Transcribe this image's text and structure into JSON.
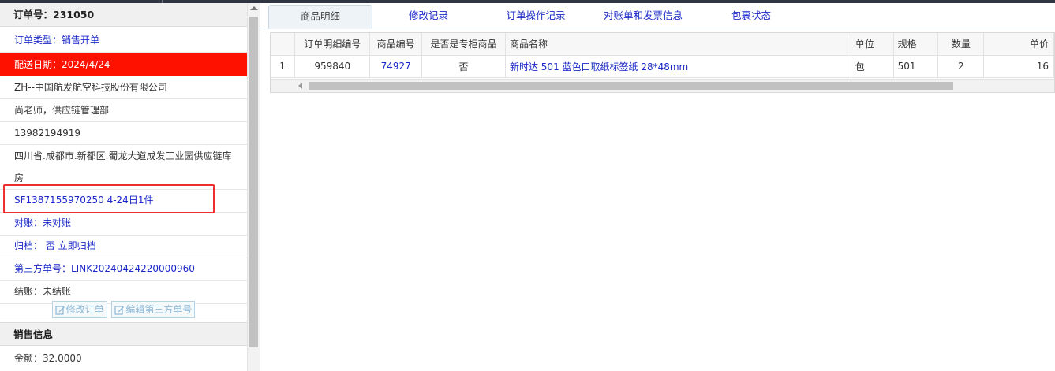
{
  "order": {
    "header": "订单号：231050",
    "type": "订单类型：销售开单",
    "delivery_date": "配送日期：2024/4/24",
    "company": "ZH--中国航发航空科技股份有限公司",
    "contact": "尚老师，供应链管理部",
    "phone": "13982194919",
    "address": "四川省.成都市.新都区.蜀龙大道成发工业园供应链库房",
    "tracking": "SF1387155970250 4-24日1件",
    "reconcile": "对账：未对账",
    "archive": "归档：  否 立即归档",
    "third_party": "第三方单号：LINK20240424220000960",
    "settle": "结账：未结账",
    "edit_order_btn": "修改订单",
    "edit_third_btn": "编辑第三方单号"
  },
  "sales": {
    "header": "销售信息",
    "amount": "金额：32.0000"
  },
  "tabs": [
    "商品明细",
    "修改记录",
    "订单操作记录",
    "对账单和发票信息",
    "包裹状态"
  ],
  "grid": {
    "columns": [
      "",
      "订单明细编号",
      "商品编号",
      "是否是专柜商品",
      "商品名称",
      "单位",
      "规格",
      "数量",
      "单价"
    ],
    "rows": [
      [
        "1",
        "959840",
        "74927",
        "否",
        "新时达 501 蓝色口取纸标签纸 28*48mm",
        "包",
        "501",
        "2",
        "16"
      ]
    ]
  },
  "colors": {
    "accent_red": "#ff1100",
    "link_blue": "#1a28c8",
    "highlight_box": "#ef2f2f"
  }
}
